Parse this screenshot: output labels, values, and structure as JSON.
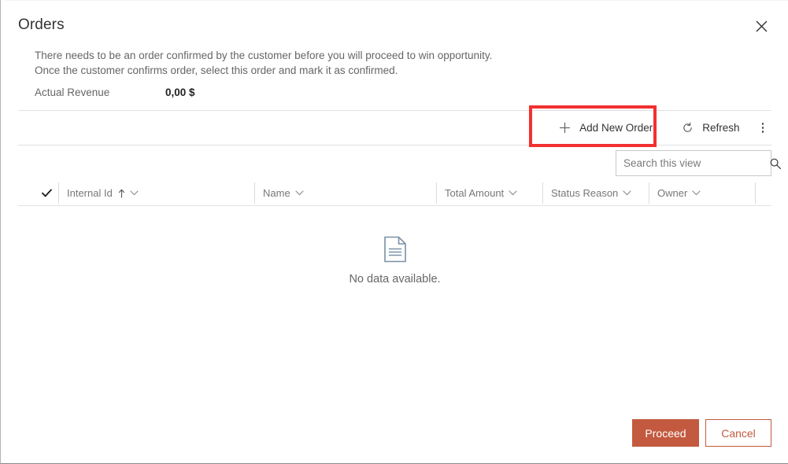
{
  "dialog": {
    "title": "Orders",
    "close_label": "Close",
    "description_lines": [
      "There needs to be an order confirmed by the customer before you will proceed to win opportunity.",
      "Once the customer confirms order, select this order and mark it as confirmed."
    ],
    "actual_revenue": {
      "label": "Actual Revenue",
      "value": "0,00 $"
    }
  },
  "toolbar": {
    "add_new_order": "Add New Order",
    "refresh": "Refresh",
    "overflow_label": "More commands",
    "highlight_color": "#f23030"
  },
  "search": {
    "placeholder": "Search this view",
    "value": ""
  },
  "grid": {
    "select_all_label": "Select all rows",
    "columns": [
      {
        "label": "Internal Id",
        "sorted": "ascending"
      },
      {
        "label": "Name",
        "sorted": ""
      },
      {
        "label": "Total Amount",
        "sorted": ""
      },
      {
        "label": "Status Reason",
        "sorted": ""
      },
      {
        "label": "Owner",
        "sorted": ""
      }
    ],
    "rows": [],
    "empty_message": "No data available."
  },
  "footer": {
    "proceed": "Proceed",
    "cancel": "Cancel",
    "accent_color": "#c35a3f"
  }
}
